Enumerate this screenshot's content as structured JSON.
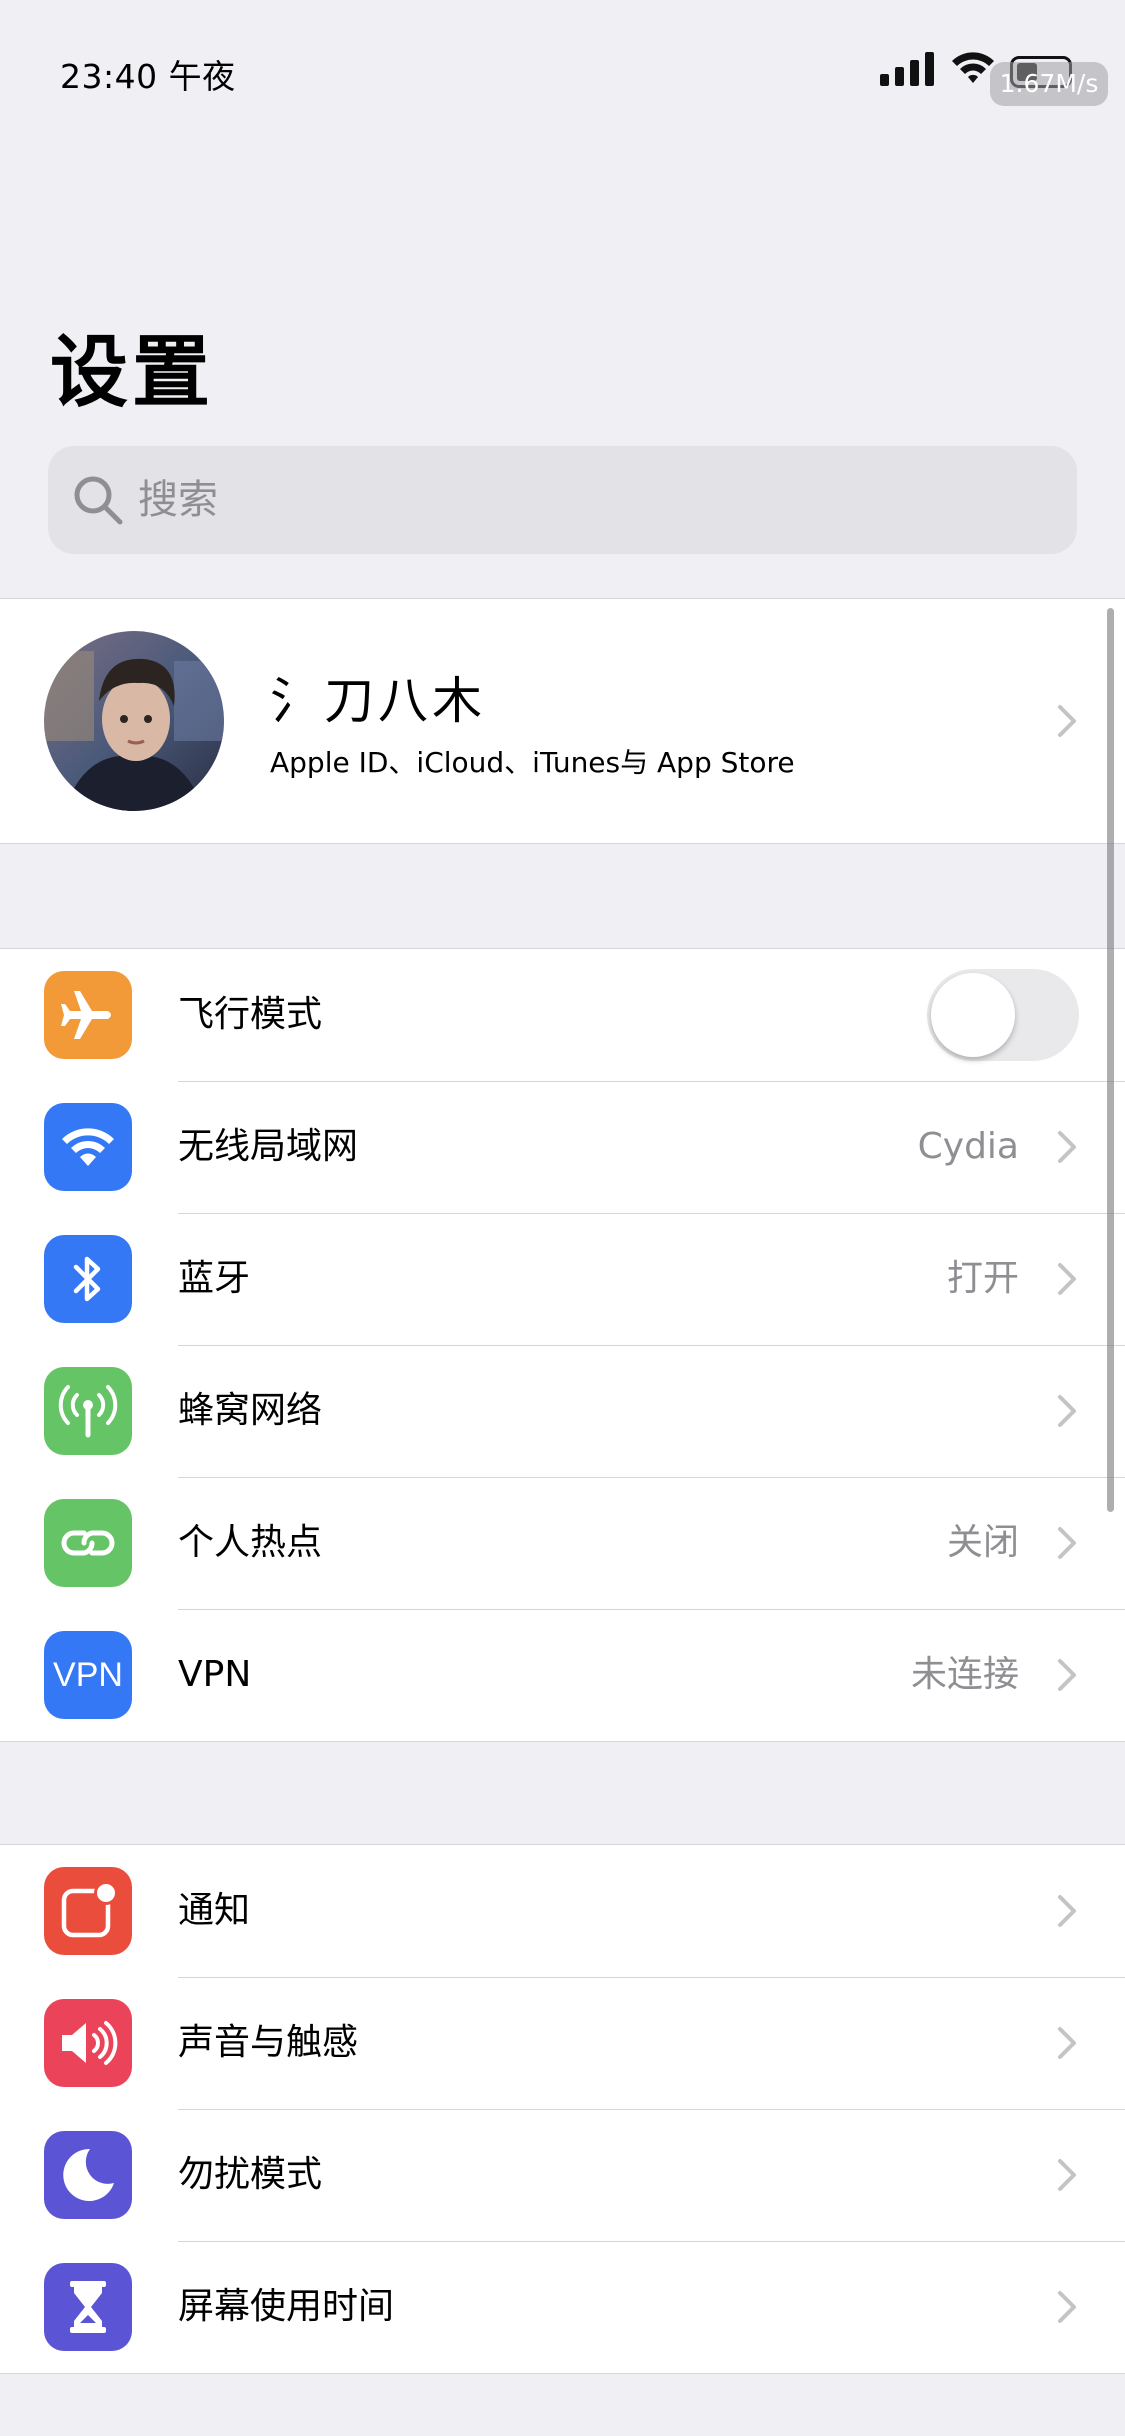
{
  "status_bar": {
    "time": "23:40 午夜",
    "net_speed": "1.67M/s"
  },
  "page_title": "设置",
  "search": {
    "placeholder": "搜索"
  },
  "profile": {
    "name": "氵刀八木",
    "subtitle": "Apple ID、iCloud、iTunes与 App Store"
  },
  "connectivity": {
    "airplane": {
      "label": "飞行模式",
      "toggle_on": false,
      "icon": "airplane-icon",
      "color": "#f29a38"
    },
    "wifi": {
      "label": "无线局域网",
      "value": "Cydia",
      "icon": "wifi-icon",
      "color": "#3478f6"
    },
    "bluetooth": {
      "label": "蓝牙",
      "value": "打开",
      "icon": "bluetooth-icon",
      "color": "#3478f6"
    },
    "cellular": {
      "label": "蜂窝网络",
      "value": "",
      "icon": "cellular-antenna-icon",
      "color": "#65c466"
    },
    "hotspot": {
      "label": "个人热点",
      "value": "关闭",
      "icon": "hotspot-icon",
      "color": "#65c466"
    },
    "vpn": {
      "label": "VPN",
      "value": "未连接",
      "icon_text": "VPN",
      "color": "#3478f6"
    }
  },
  "general": {
    "notifications": {
      "label": "通知",
      "icon": "notification-icon",
      "color": "#eb4d3d"
    },
    "sounds": {
      "label": "声音与触感",
      "icon": "speaker-icon",
      "color": "#eb445a"
    },
    "dnd": {
      "label": "勿扰模式",
      "icon": "moon-icon",
      "color": "#5b55d6"
    },
    "screentime": {
      "label": "屏幕使用时间",
      "icon": "hourglass-icon",
      "color": "#5b55d6"
    }
  }
}
